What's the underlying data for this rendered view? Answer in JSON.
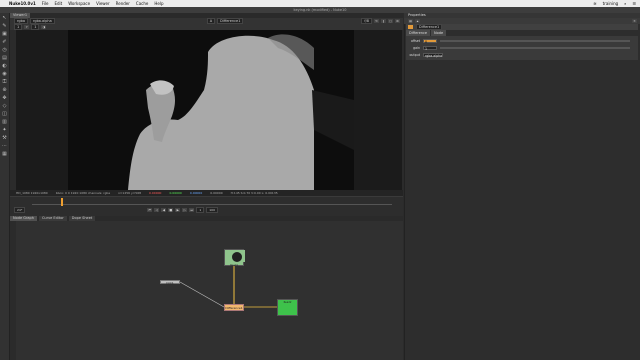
{
  "menubar": {
    "apple": "",
    "app_name": "Nuke10.0v1",
    "items": [
      "File",
      "Edit",
      "Workspace",
      "Viewer",
      "Render",
      "Cache",
      "Help"
    ],
    "right_text": "training"
  },
  "window": {
    "title": "keying.nk (modified) - Nuke10"
  },
  "viewer": {
    "tab_label": "Viewer1",
    "channel_select": "rgba",
    "layer_select": "rgba.alpha",
    "input_a": "A",
    "input_b": "B",
    "compare_label": "Difference1",
    "zoom": "f/8",
    "exposure_label": "Y",
    "exposure_value": "1",
    "format_text": "HD_1080 1920x1080",
    "info_text": "bbox: 0 0 1920 1080 channels: rgba",
    "coord_text": "x=1256 y=568",
    "r_val": "0.00000",
    "g_val": "0.00000",
    "b_val": "0.00000",
    "a_val": "0.00000",
    "hsv_text": "H:145 S:0.70 V:0.00 L: 0.00135",
    "frame": "1",
    "fps": "24*",
    "frame_total": "100"
  },
  "node_graph": {
    "tabs": [
      "Node Graph",
      "Curve Editor",
      "Dope Sheet"
    ],
    "nodes": {
      "read1": "Read1",
      "read2": "Read2",
      "merge": "Difference1",
      "dot": "Dot1"
    }
  },
  "properties": {
    "title": "Properties",
    "node_name": "Difference1",
    "tabs": [
      "Difference",
      "Node"
    ],
    "rows": [
      {
        "label": "offset",
        "value": "0"
      },
      {
        "label": "gain",
        "value": "1"
      },
      {
        "label": "output",
        "value": "rgba.alpha"
      }
    ]
  },
  "colors": {
    "read_node": "#8fc48c",
    "constant_node": "#3ec24b",
    "merge_node": "#f2b86e",
    "accent": "#e29a3a"
  }
}
